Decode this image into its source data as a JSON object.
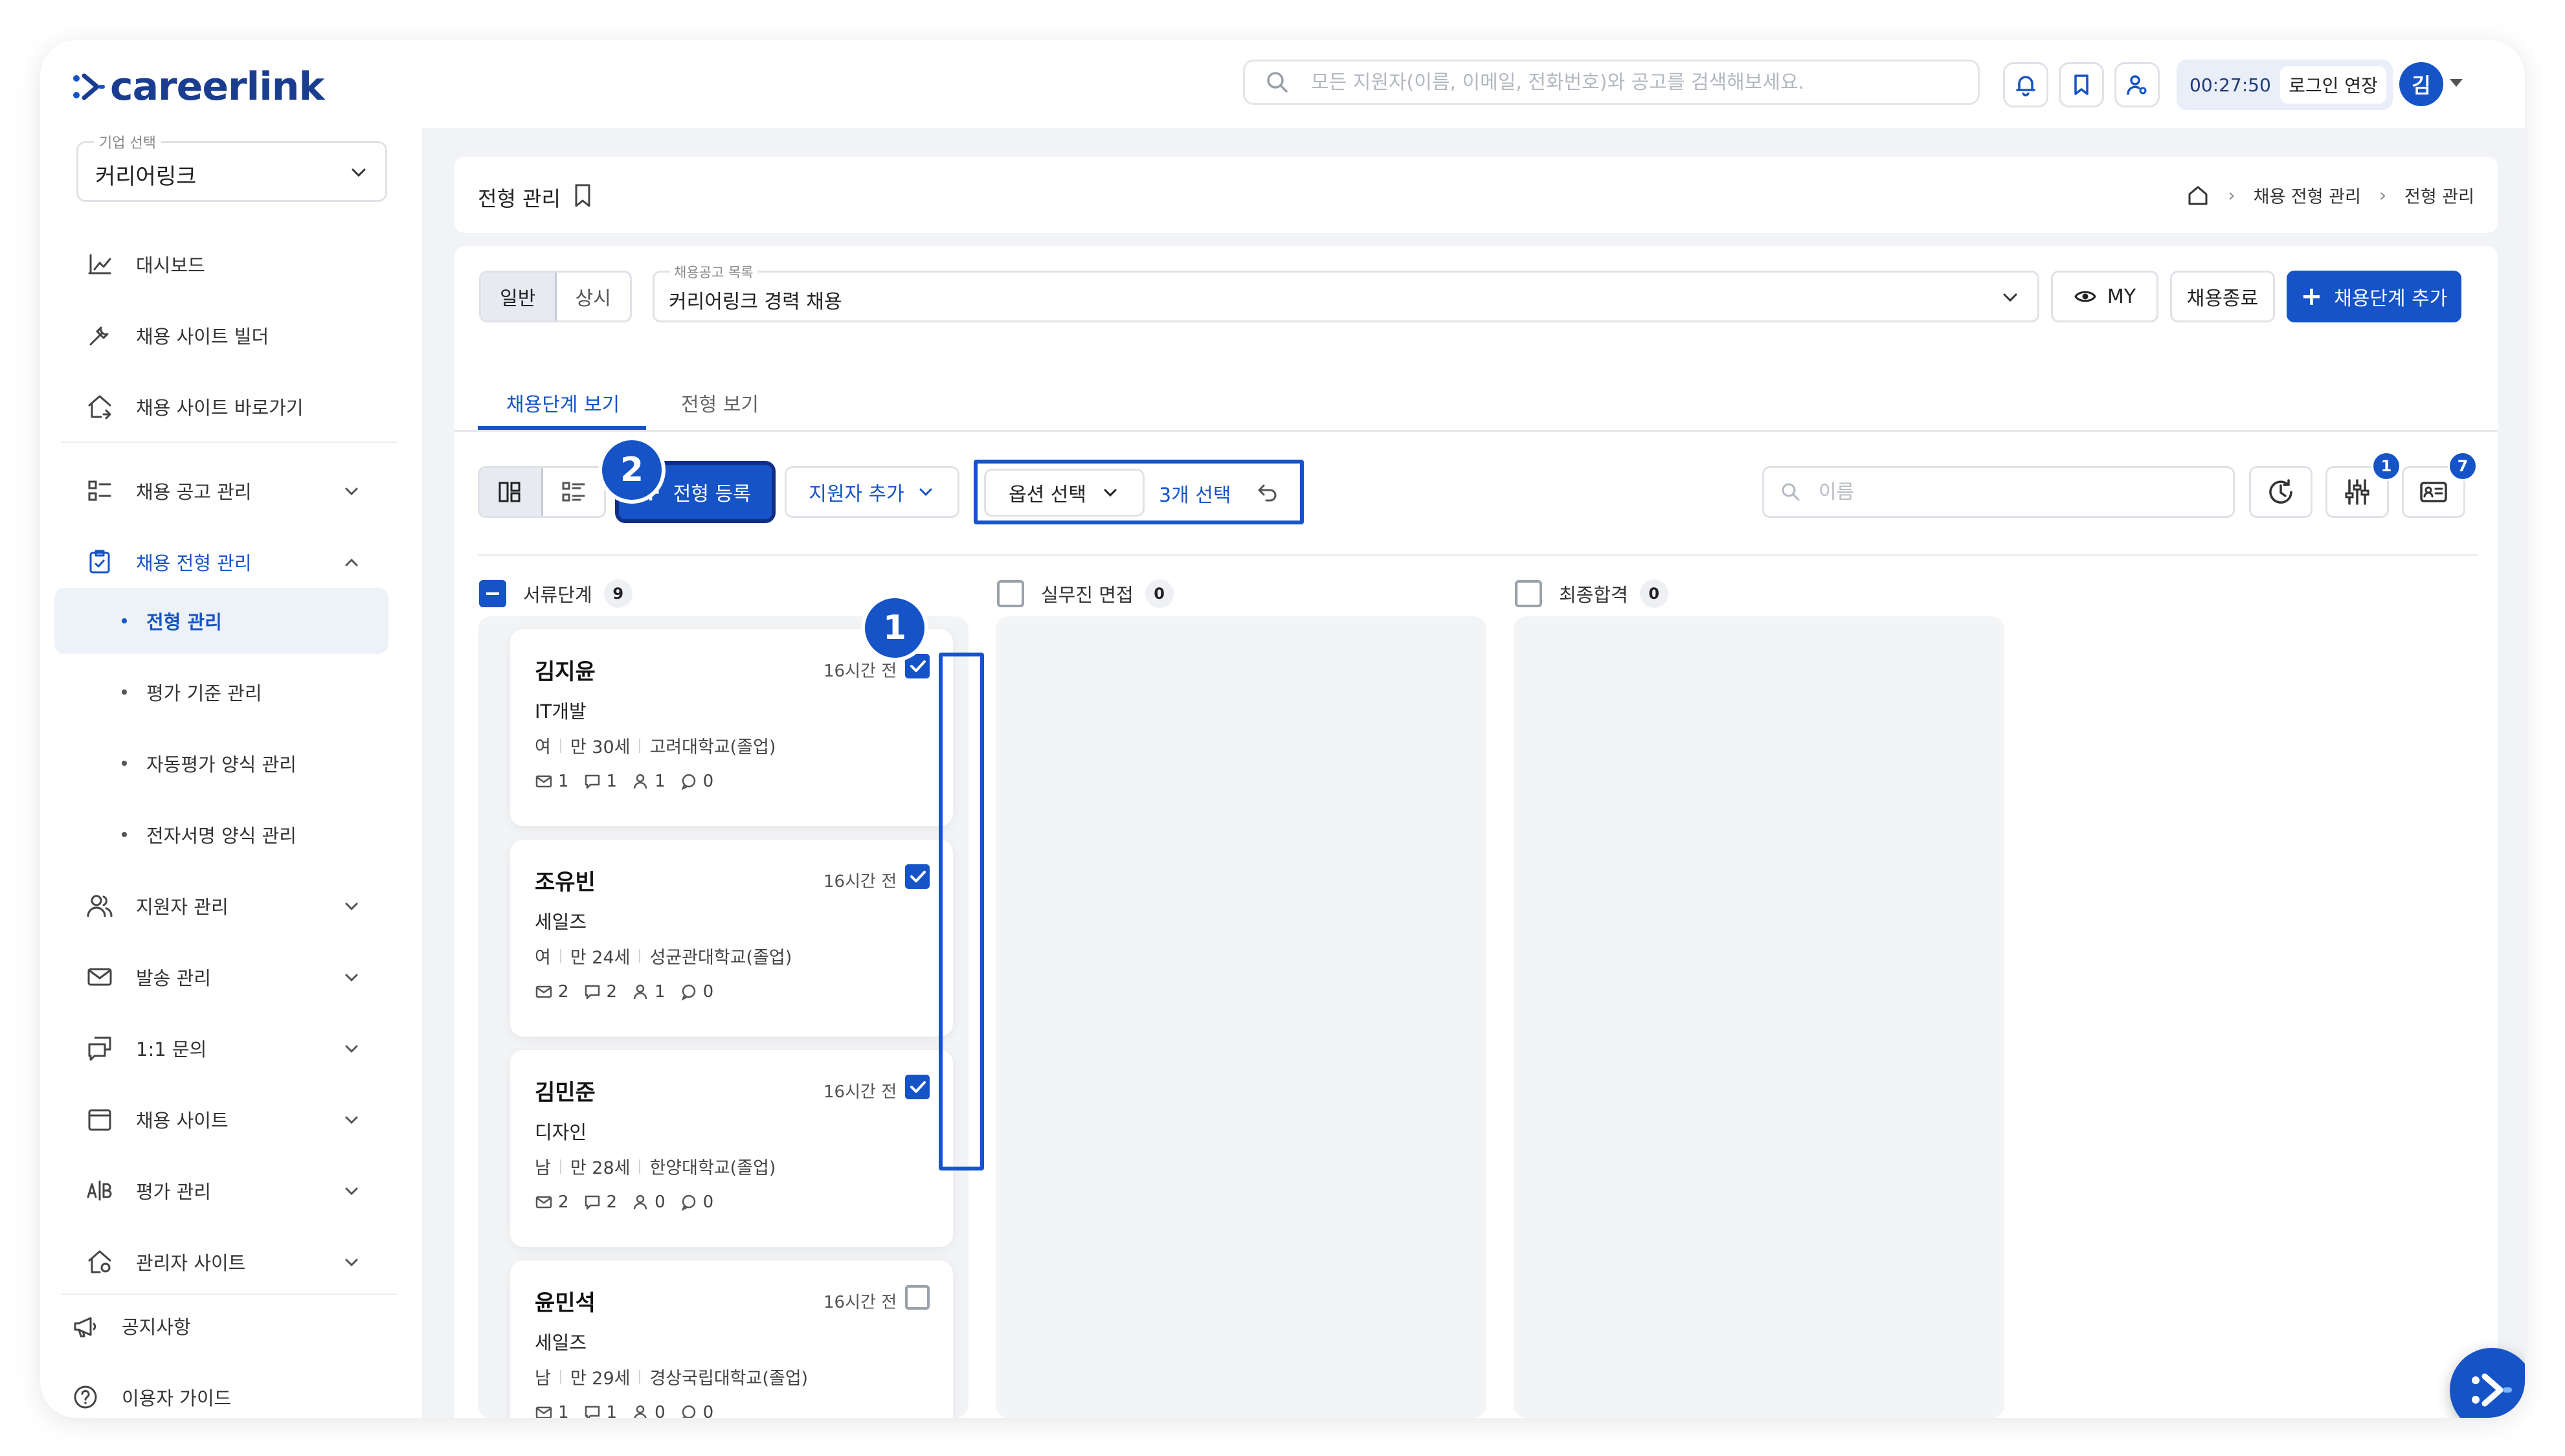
{
  "brand": {
    "logo_text": "careerlink",
    "primary_color": "#1553c7"
  },
  "topbar": {
    "search_placeholder": "모든 지원자(이름, 이메일, 전화번호)와 공고를 검색해보세요.",
    "session_time": "00:27:50",
    "extend_label": "로그인 연장",
    "avatar_initial": "김"
  },
  "sidebar": {
    "company_label": "기업 선택",
    "company_value": "커리어링크",
    "items": [
      {
        "label": "대시보드",
        "icon": "chart-icon"
      },
      {
        "label": "채용 사이트 빌더",
        "icon": "tools-icon"
      },
      {
        "label": "채용 사이트 바로가기",
        "icon": "home-link-icon"
      },
      {
        "label": "채용 공고 관리",
        "icon": "list-icon"
      },
      {
        "label": "채용 전형 관리",
        "icon": "clipboard-icon"
      },
      {
        "label": "지원자 관리",
        "icon": "users-icon"
      },
      {
        "label": "발송 관리",
        "icon": "mail-icon"
      },
      {
        "label": "1:1 문의",
        "icon": "chat-icon"
      },
      {
        "label": "채용 사이트",
        "icon": "calendar-icon"
      },
      {
        "label": "평가 관리",
        "icon": "ab-icon"
      },
      {
        "label": "관리자 사이트",
        "icon": "admin-home-icon"
      },
      {
        "label": "공지사항",
        "icon": "megaphone-icon"
      },
      {
        "label": "이용자 가이드",
        "icon": "help-icon"
      }
    ],
    "sub_items": [
      "전형 관리",
      "평가 기준 관리",
      "자동평가 양식 관리",
      "전자서명 양식 관리"
    ]
  },
  "header": {
    "title": "전형 관리",
    "breadcrumb": [
      "채용 전형 관리",
      "전형 관리"
    ]
  },
  "filters": {
    "segments": [
      "일반",
      "상시"
    ],
    "job_list_label": "채용공고 목록",
    "job_list_value": "커리어링크 경력 채용",
    "my_label": "MY",
    "close_label": "채용종료",
    "add_stage_label": "채용단계 추가"
  },
  "tabs": [
    "채용단계 보기",
    "전형 보기"
  ],
  "toolbar": {
    "register_label": "전형 등록",
    "add_applicant_label": "지원자 추가",
    "option_select_label": "옵션 선택",
    "selected_count_label": "3개 선택",
    "name_placeholder": "이름",
    "filter_badge": "1",
    "card_badge": "7"
  },
  "steps": [
    "1",
    "2"
  ],
  "columns": [
    {
      "title": "서류단계",
      "count": "9"
    },
    {
      "title": "실무진 면접",
      "count": "0"
    },
    {
      "title": "최종합격",
      "count": "0"
    }
  ],
  "cards": [
    {
      "name": "김지윤",
      "time": "16시간 전",
      "job": "IT개발",
      "gender": "여",
      "age": "만 30세",
      "school": "고려대학교(졸업)",
      "mail": "1",
      "comment": "1",
      "eval": "1",
      "chat": "0",
      "checked": true
    },
    {
      "name": "조유빈",
      "time": "16시간 전",
      "job": "세일즈",
      "gender": "여",
      "age": "만 24세",
      "school": "성균관대학교(졸업)",
      "mail": "2",
      "comment": "2",
      "eval": "1",
      "chat": "0",
      "checked": true
    },
    {
      "name": "김민준",
      "time": "16시간 전",
      "job": "디자인",
      "gender": "남",
      "age": "만 28세",
      "school": "한양대학교(졸업)",
      "mail": "2",
      "comment": "2",
      "eval": "0",
      "chat": "0",
      "checked": true
    },
    {
      "name": "윤민석",
      "time": "16시간 전",
      "job": "세일즈",
      "gender": "남",
      "age": "만 29세",
      "school": "경상국립대학교(졸업)",
      "mail": "1",
      "comment": "1",
      "eval": "0",
      "chat": "0",
      "checked": false
    }
  ]
}
